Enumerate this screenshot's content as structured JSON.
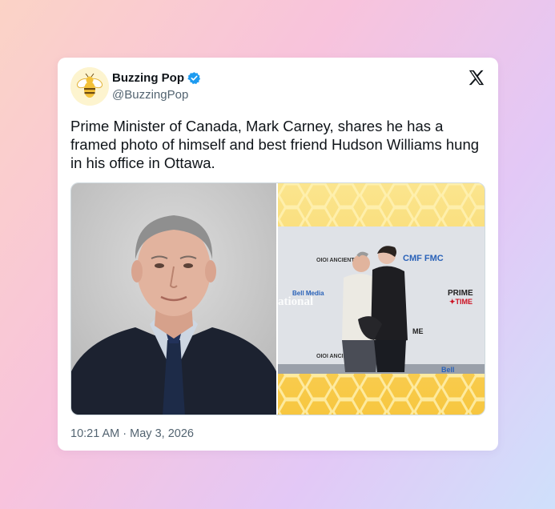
{
  "tweet": {
    "display_name": "Buzzing Pop",
    "handle": "@BuzzingPop",
    "text": "Prime Minister of Canada, Mark Carney, shares he has a framed photo of himself and best friend Hudson Williams hung in his office in Ottawa.",
    "timestamp": "10:21 AM · May 3, 2026",
    "verified": true
  },
  "media": {
    "left_photo": "portrait of man in suit",
    "right_photo": "two men posing at press wall",
    "press_wall_logos": [
      "CMF FMC",
      "PRIME TIME",
      "Bell Media",
      "ational",
      "ME TIME"
    ]
  },
  "icons": {
    "avatar": "bee-icon",
    "verified": "verified-badge-icon",
    "platform": "x-logo-icon"
  },
  "colors": {
    "verified_blue": "#1d9bf0",
    "text": "#0f1419",
    "secondary": "#536471",
    "honey": "#f6c33b"
  }
}
